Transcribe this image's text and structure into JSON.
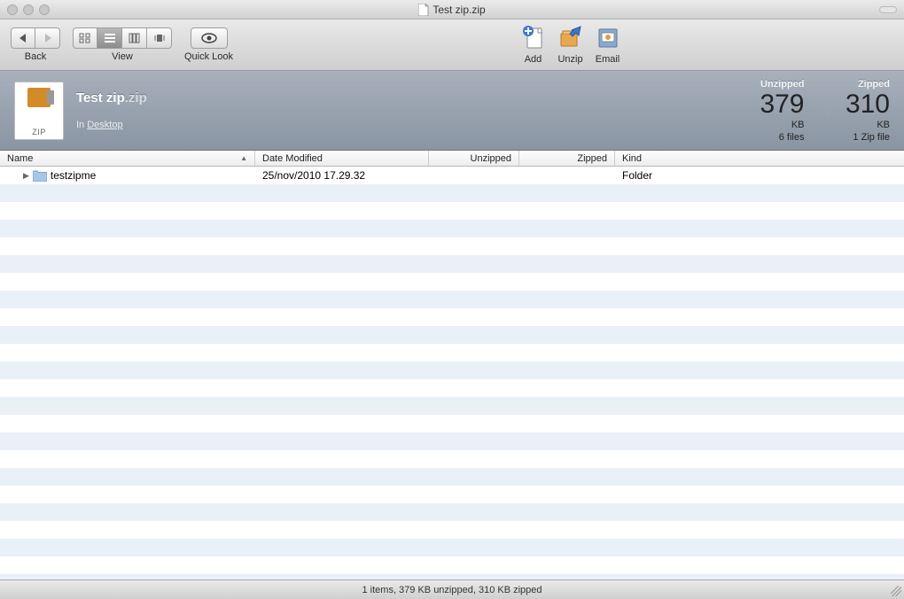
{
  "window": {
    "title": "Test zip.zip"
  },
  "toolbar": {
    "back_label": "Back",
    "view_label": "View",
    "quicklook_label": "Quick Look",
    "add_label": "Add",
    "unzip_label": "Unzip",
    "email_label": "Email"
  },
  "info": {
    "file_name": "Test zip",
    "file_ext": ".zip",
    "location_prefix": "In ",
    "location_link": "Desktop",
    "zip_icon_label": "ZIP",
    "unzipped": {
      "label": "Unzipped",
      "value": "379",
      "unit": "KB",
      "sub": "6 files"
    },
    "zipped": {
      "label": "Zipped",
      "value": "310",
      "unit": "KB",
      "sub": "1 Zip file"
    }
  },
  "columns": {
    "name": "Name",
    "date": "Date Modified",
    "unzipped": "Unzipped",
    "zipped": "Zipped",
    "kind": "Kind"
  },
  "rows": [
    {
      "name": "testzipme",
      "date": "25/nov/2010 17.29.32",
      "unzipped": "",
      "zipped": "",
      "kind": "Folder"
    }
  ],
  "status": "1 items, 379 KB unzipped, 310 KB zipped"
}
